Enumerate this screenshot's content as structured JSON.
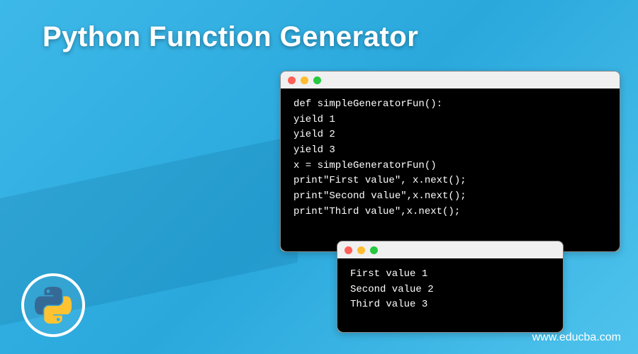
{
  "title": "Python Function Generator",
  "code_main": [
    "def simpleGeneratorFun():",
    "yield 1",
    "yield 2",
    "yield 3",
    "x = simpleGeneratorFun()",
    "print\"First value\", x.next();",
    "print\"Second value\",x.next();",
    "print\"Third value\",x.next();"
  ],
  "code_output": [
    "First value 1",
    "Second value 2",
    "Third value 3"
  ],
  "site_url": "www.educba.com",
  "logo_alt": "python-logo"
}
